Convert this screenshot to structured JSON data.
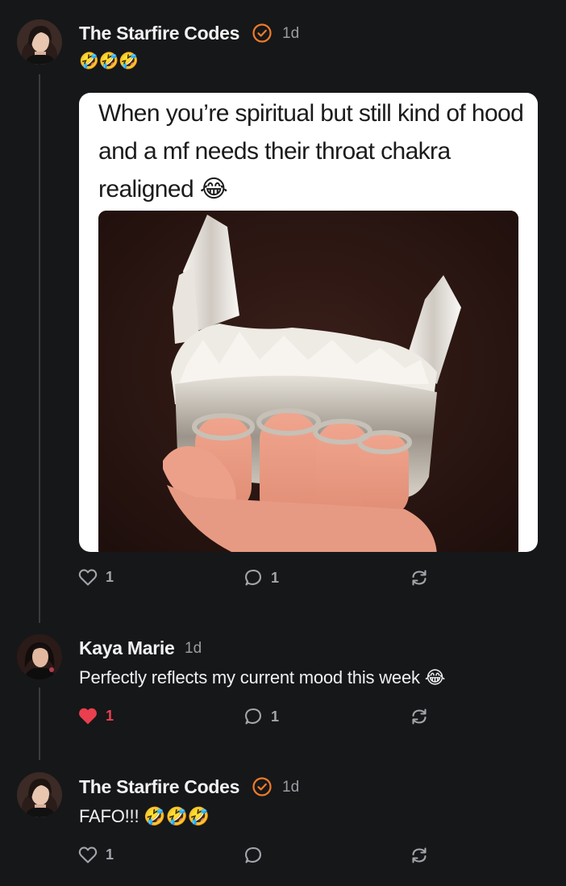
{
  "posts": [
    {
      "author": "The Starfire Codes",
      "verified": true,
      "time": "1d",
      "text": "🤣🤣🤣",
      "image": {
        "caption": "When you’re spiritual but still kind of hood and a mf needs their throat chakra realigned 😂",
        "photo_icon": "crystal-brass-knuckles"
      },
      "likes": "1",
      "liked": false,
      "replies": "1",
      "reposts": ""
    },
    {
      "author": "Kaya Marie",
      "verified": false,
      "time": "1d",
      "text": "Perfectly reflects my current mood this week 😂",
      "likes": "1",
      "liked": true,
      "replies": "1",
      "reposts": ""
    },
    {
      "author": "The Starfire Codes",
      "verified": true,
      "time": "1d",
      "text": "FAFO!!! 🤣🤣🤣",
      "likes": "1",
      "liked": false,
      "replies": "",
      "reposts": ""
    }
  ],
  "colors": {
    "background": "#161719",
    "verified_badge": "#f07b2a",
    "like_active": "#ea3f4f",
    "muted": "#a3a5aa"
  }
}
